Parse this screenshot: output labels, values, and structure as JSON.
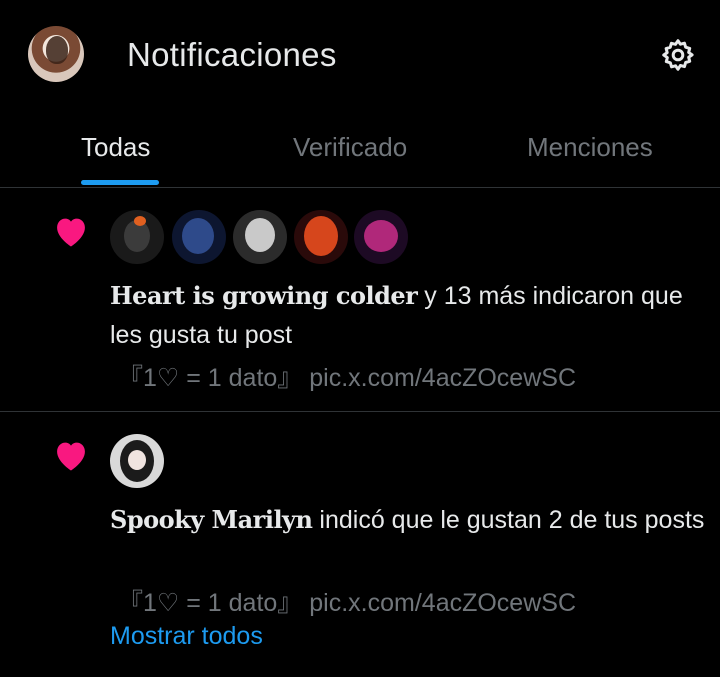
{
  "header": {
    "title": "Notificaciones",
    "avatar_icon": "user-avatar",
    "settings_icon": "gear-icon"
  },
  "tabs": [
    {
      "label": "Todas",
      "active": true
    },
    {
      "label": "Verificado",
      "active": false
    },
    {
      "label": "Menciones",
      "active": false
    }
  ],
  "colors": {
    "accent": "#1d9bf0",
    "heart": "#f91880",
    "muted": "#71767b",
    "text": "#e7e9ea"
  },
  "notifications": [
    {
      "icon": "heart-icon",
      "user": "Heart is growing colder",
      "action": " y 13 más indicaron que les gusta tu post",
      "post_text": "『1♡ = 1 dato』 pic.x.com/4acZOcewSC",
      "avatar_count": 5
    },
    {
      "icon": "heart-icon",
      "user": "Spooky Marilyn",
      "action": " indicó que le gustan 2 de tus posts",
      "post_text": "『1♡ = 1 dato』 pic.x.com/4acZOcewSC",
      "show_all": "Mostrar todos",
      "avatar_count": 1
    }
  ]
}
